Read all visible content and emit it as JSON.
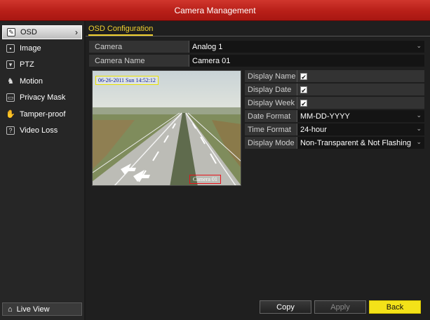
{
  "window": {
    "title": "Camera Management"
  },
  "sidebar": {
    "items": [
      {
        "label": "OSD",
        "icon": "osd-icon",
        "active": true
      },
      {
        "label": "Image",
        "icon": "image-icon"
      },
      {
        "label": "PTZ",
        "icon": "ptz-icon"
      },
      {
        "label": "Motion",
        "icon": "motion-icon"
      },
      {
        "label": "Privacy Mask",
        "icon": "privacy-mask-icon"
      },
      {
        "label": "Tamper-proof",
        "icon": "tamper-proof-icon"
      },
      {
        "label": "Video Loss",
        "icon": "video-loss-icon"
      }
    ],
    "live_view": {
      "label": "Live View",
      "icon": "home-icon"
    }
  },
  "main": {
    "tab": "OSD Configuration",
    "camera": {
      "label": "Camera",
      "value": "Analog 1"
    },
    "camera_name": {
      "label": "Camera Name",
      "value": "Camera 01"
    },
    "preview": {
      "osd_datetime": "06-26-2011 Sun 14:52:12",
      "osd_camera_name": "Camera 01"
    },
    "fields": {
      "display_name": {
        "label": "Display Name",
        "checked": true
      },
      "display_date": {
        "label": "Display Date",
        "checked": true
      },
      "display_week": {
        "label": "Display Week",
        "checked": true
      },
      "date_format": {
        "label": "Date Format",
        "value": "MM-DD-YYYY"
      },
      "time_format": {
        "label": "Time Format",
        "value": "24-hour"
      },
      "display_mode": {
        "label": "Display Mode",
        "value": "Non-Transparent & Not Flashing"
      }
    },
    "buttons": {
      "copy": "Copy",
      "apply": "Apply",
      "back": "Back"
    }
  },
  "colors": {
    "title_red": "#c0261e",
    "accent_yellow": "#f2d230",
    "back_button": "#f3e219"
  }
}
